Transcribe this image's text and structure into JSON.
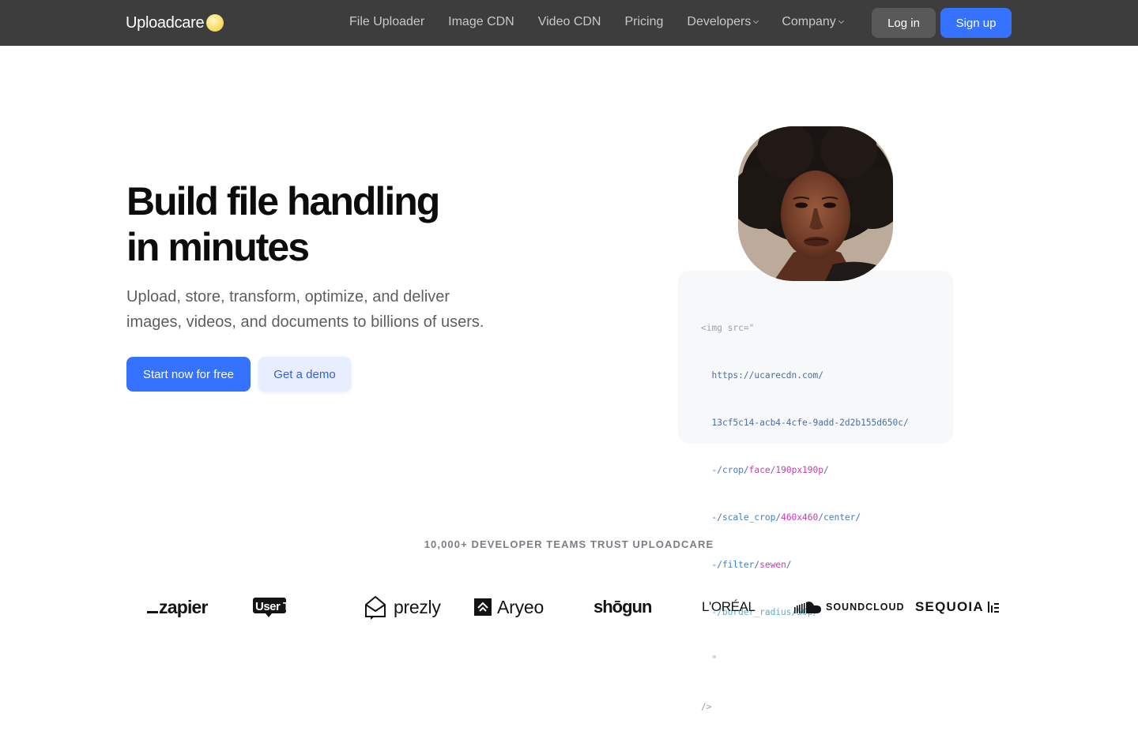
{
  "header": {
    "logo_text": "Uploadcare",
    "nav": [
      {
        "label": "File Uploader",
        "has_dropdown": false
      },
      {
        "label": "Image CDN",
        "has_dropdown": false
      },
      {
        "label": "Video CDN",
        "has_dropdown": false
      },
      {
        "label": "Pricing",
        "has_dropdown": false
      },
      {
        "label": "Developers",
        "has_dropdown": true
      },
      {
        "label": "Company",
        "has_dropdown": true
      }
    ],
    "login_label": "Log in",
    "signup_label": "Sign up"
  },
  "hero": {
    "title_line1": "Build file handling",
    "title_line2": "in minutes",
    "subtitle_line1": "Upload, store, transform, optimize, and deliver",
    "subtitle_line2": "images, videos, and documents to billions of users.",
    "cta_primary": "Start now for free",
    "cta_secondary": "Get a demo"
  },
  "code_sample": {
    "open": "<img src=\"",
    "host": "https://ucarecdn.com/",
    "uuid": "13cf5c14-acb4-4cfe-9add-2d2b155d650c/",
    "ops": [
      {
        "sep": "-/",
        "op": "crop",
        "args": [
          "face",
          "190px190p"
        ]
      },
      {
        "sep": "-/",
        "op": "scale_crop",
        "args": [
          "460x460",
          "center"
        ]
      },
      {
        "sep": "-/",
        "op": "filter",
        "args": [
          "sewen"
        ]
      },
      {
        "sep": "-/",
        "op": "border_radius",
        "args": [
          "50p"
        ]
      }
    ],
    "quote": "\"",
    "close": "/>"
  },
  "trust": {
    "heading": "10,000+ DEVELOPER TEAMS TRUST UPLOADCARE",
    "brands": [
      "zapier",
      "User Testing",
      "prezly",
      "Aryeo",
      "shōgun",
      "L'ORÉAL",
      "SOUNDCLOUD",
      "SEQUOIA"
    ]
  },
  "colors": {
    "header_bg": "#3d3d3d",
    "accent": "#3572ff",
    "secondary_button_bg": "#e8eeff",
    "code_card_bg": "#f6f8fa"
  }
}
